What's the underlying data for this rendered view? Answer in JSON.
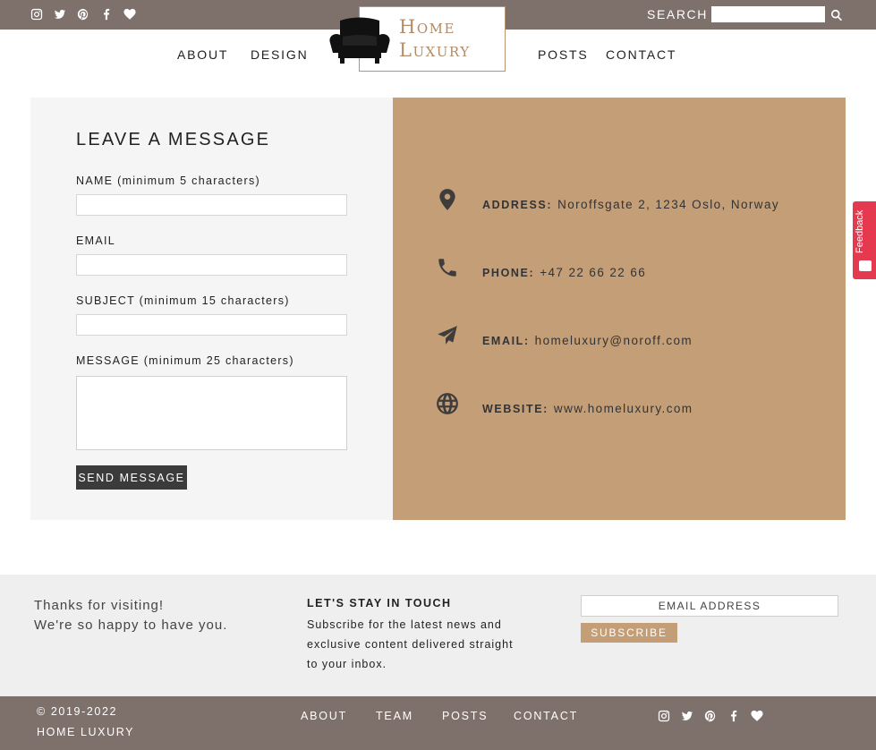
{
  "topbar": {
    "social_icons": [
      "instagram-icon",
      "twitter-icon",
      "pinterest-icon",
      "facebook-icon",
      "heart-icon"
    ],
    "search_label": "SEARCH",
    "search_value": "",
    "search_icon": "search-icon"
  },
  "nav": {
    "left": [
      "ABOUT",
      "DESIGN"
    ],
    "right": [
      "POSTS",
      "CONTACT"
    ],
    "logo_icon": "armchair-icon",
    "logo_line1": "Home",
    "logo_line2": "Luxury"
  },
  "form": {
    "title": "LEAVE A MESSAGE",
    "name_label": "NAME (minimum 5 characters)",
    "email_label": "EMAIL",
    "subject_label": "SUBJECT (minimum 15 characters)",
    "message_label": "MESSAGE (minimum 25 characters)",
    "name_value": "",
    "email_value": "",
    "subject_value": "",
    "message_value": "",
    "send_label": "SEND MESSAGE"
  },
  "info": {
    "address_key": "ADDRESS:",
    "address_value": "Noroffsgate 2, 1234 Oslo, Norway",
    "phone_key": "PHONE:",
    "phone_value": "+47 22 66 22 66",
    "email_key": "EMAIL:",
    "email_value": "homeluxury@noroff.com",
    "website_key": "WEBSITE:",
    "website_value": "www.homeluxury.com",
    "icons": [
      "map-pin-icon",
      "phone-icon",
      "paper-plane-icon",
      "globe-icon"
    ]
  },
  "feedback": {
    "label": "Feedback",
    "color": "#e5394f"
  },
  "newsletter": {
    "thanks_line1": "Thanks for visiting!",
    "thanks_line2": "We're so happy to have you.",
    "title": "LET'S STAY IN TOUCH",
    "text_line1": "Subscribe for the latest news and",
    "text_line2": "exclusive content delivered straight",
    "text_line3": "to your inbox.",
    "email_placeholder": "EMAIL ADDRESS",
    "subscribe_label": "SUBSCRIBE"
  },
  "footer": {
    "copyright": "© 2019-2022",
    "brand": "HOME LUXURY",
    "links": [
      "ABOUT",
      "TEAM",
      "POSTS",
      "CONTACT"
    ]
  },
  "colors": {
    "bar": "#7e706a",
    "accent": "#c49e76",
    "panel": "#f5f5f5",
    "band": "#efefef",
    "button": "#3b3b3b"
  }
}
